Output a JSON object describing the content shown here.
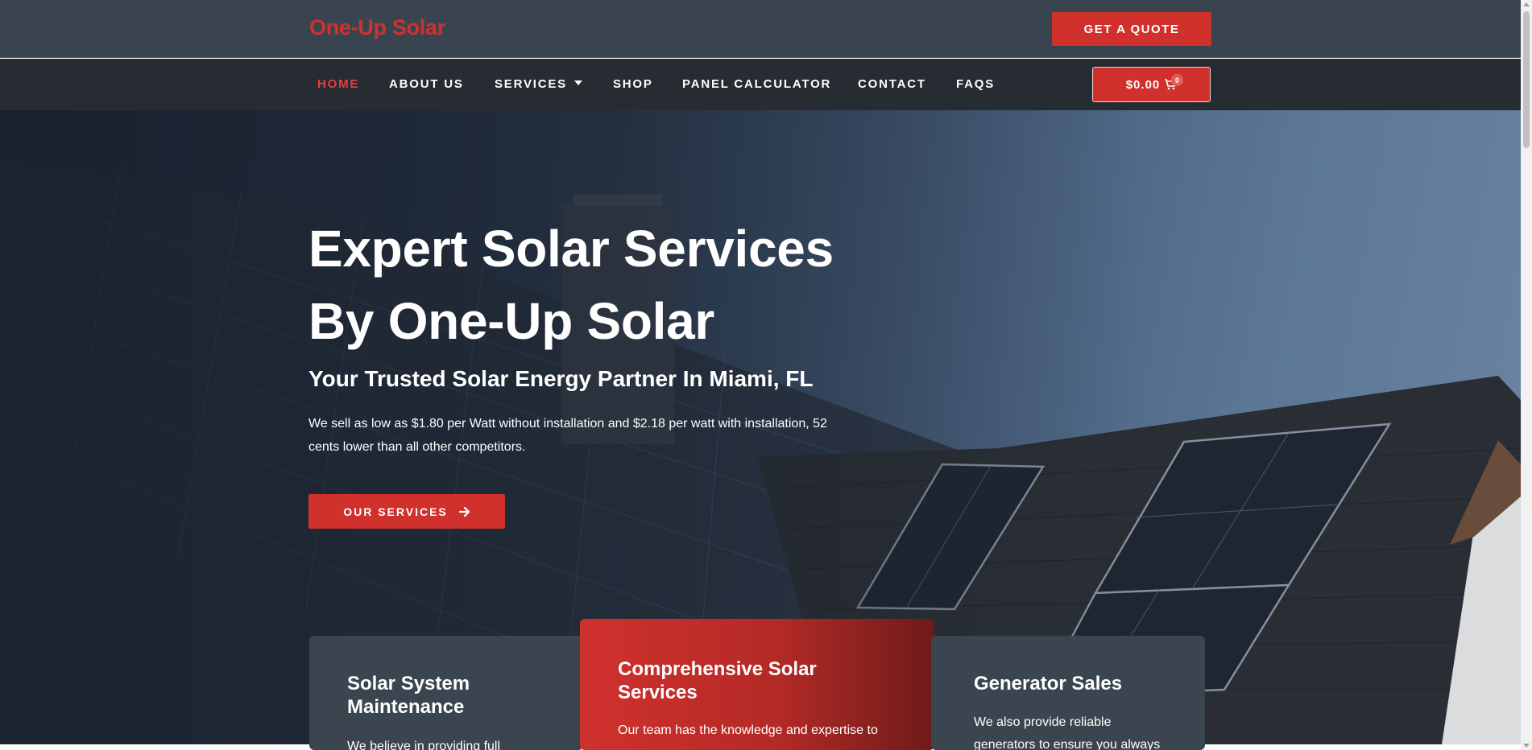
{
  "header": {
    "logo": "One-Up Solar",
    "quote_button": "GET A QUOTE"
  },
  "nav": {
    "items": [
      {
        "label": "HOME",
        "active": true
      },
      {
        "label": "ABOUT US"
      },
      {
        "label": "SERVICES"
      },
      {
        "label": "SHOP"
      },
      {
        "label": "PANEL CALCULATOR"
      },
      {
        "label": "CONTACT"
      },
      {
        "label": "FAQS"
      }
    ],
    "cart_total": "$0.00",
    "cart_count": "0"
  },
  "hero": {
    "title_line1": "Expert Solar Services",
    "title_line2": "By One-Up Solar",
    "subtitle": "Your Trusted Solar Energy Partner In Miami, FL",
    "text": "We sell as low as $1.80 per Watt without installation and $2.18 per watt with installation, 52 cents lower than all other competitors.",
    "button": "OUR SERVICES"
  },
  "cards": [
    {
      "title": "Solar System Maintenance",
      "text": "We believe in providing full"
    },
    {
      "title": "Comprehensive Solar Services",
      "text": "Our team has the knowledge and expertise to"
    },
    {
      "title": "Generator Sales",
      "text": "We also provide reliable generators to ensure you always"
    }
  ],
  "colors": {
    "accent": "#d0312d",
    "topbar": "#3a4450",
    "navbar": "#262c32",
    "card_gray": "#3b454f"
  }
}
